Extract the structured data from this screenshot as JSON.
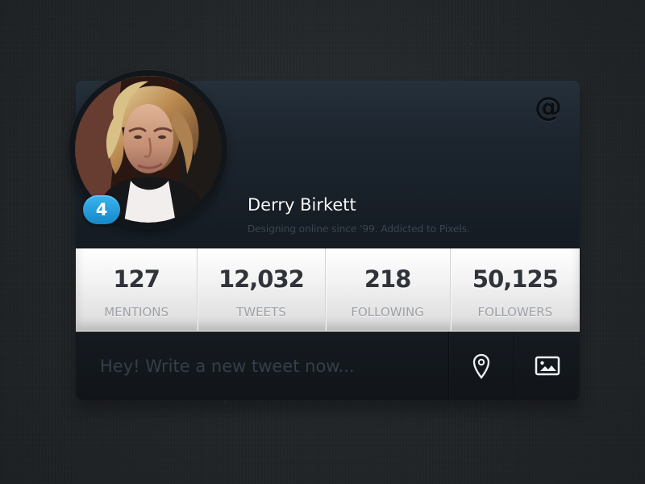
{
  "profile": {
    "name": "Derry Birkett",
    "bio": "Designing online since '99. Addicted to Pixels.",
    "notification_count": "4",
    "mention_symbol": "@"
  },
  "stats": [
    {
      "value": "127",
      "label": "MENTIONS"
    },
    {
      "value": "12,032",
      "label": "TWEETS"
    },
    {
      "value": "218",
      "label": "FOLLOWING"
    },
    {
      "value": "50,125",
      "label": "FOLLOWERS"
    }
  ],
  "composer": {
    "placeholder": "Hey! Write a new tweet now...",
    "value": ""
  },
  "icons": {
    "mention": "at-icon",
    "location": "location-pin-icon",
    "image": "image-icon"
  },
  "colors": {
    "background": "#25292c",
    "card": "#151a20",
    "badge": "#2199d8",
    "stats_text": "#30343a",
    "stats_label": "#9ca0a5"
  }
}
